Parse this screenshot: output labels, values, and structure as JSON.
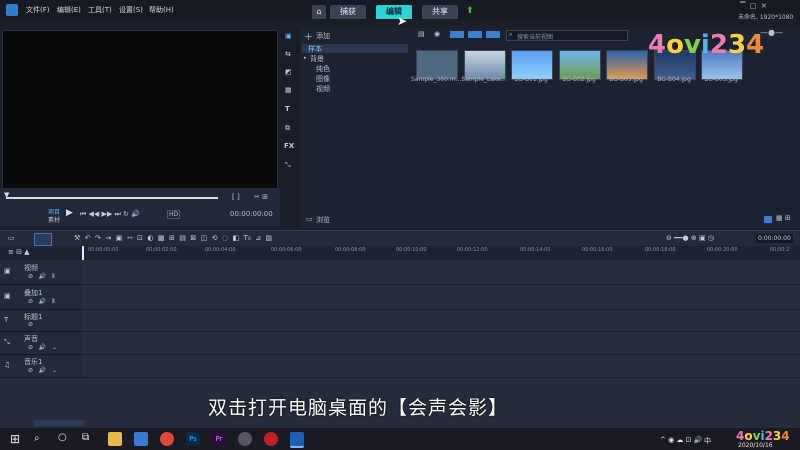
{
  "menu": [
    "文件(F)",
    "编辑(E)",
    "工具(T)",
    "设置(S)",
    "帮助(H)"
  ],
  "tabs": {
    "home_icon": "home-icon",
    "capture": "捕获",
    "edit": "编辑",
    "share": "共享"
  },
  "project_info": "未命名, 1920*1080",
  "preview": {
    "mode_top": "项目",
    "mode_bottom": "素材",
    "timecode": "00:00:00:00",
    "fit_label": "HD",
    "bracket": "[ ]"
  },
  "library_nav": {
    "add_label": "添加",
    "sample_label": "样本",
    "background_label": "背景",
    "children": [
      "纯色",
      "图像",
      "视频"
    ],
    "browse_label": "浏览"
  },
  "library": {
    "search_placeholder": "搜索当前视图",
    "thumbnails": [
      {
        "label": "Sample_360.m...",
        "color": "#506a82"
      },
      {
        "label": "Sample_Lake...",
        "color": "#9fb6c8"
      },
      {
        "label": "BG-B01.jpg",
        "color": "#3e7ed8"
      },
      {
        "label": "BG-B02.jpg",
        "color": "#7aa56a"
      },
      {
        "label": "BG-B03.jpg",
        "color": "#c77a40"
      },
      {
        "label": "BG-B04.jpg",
        "color": "#2a4060"
      },
      {
        "label": "BG-B05.jpg",
        "color": "#5e86c4"
      }
    ]
  },
  "timeline": {
    "timecode": "0:00:00:00",
    "ruler": [
      "00:00:00:00",
      "00:00:02:00",
      "00:00:04:00",
      "00:00:06:00",
      "00:00:08:00",
      "00:00:10:00",
      "00:00:12:00",
      "00:00:14:00",
      "00:00:16:00",
      "00:00:18:00",
      "00:00:20:00",
      "00:00:2"
    ],
    "tracks": [
      "视频",
      "叠加1",
      "标题1",
      "声音",
      "音乐1"
    ]
  },
  "subtitle": "双击打开电脑桌面的【会声会影】",
  "watermark": "4ovi234",
  "taskbar": {
    "date": "2020/10/16",
    "ime": "中",
    "time_small": "10:06"
  }
}
